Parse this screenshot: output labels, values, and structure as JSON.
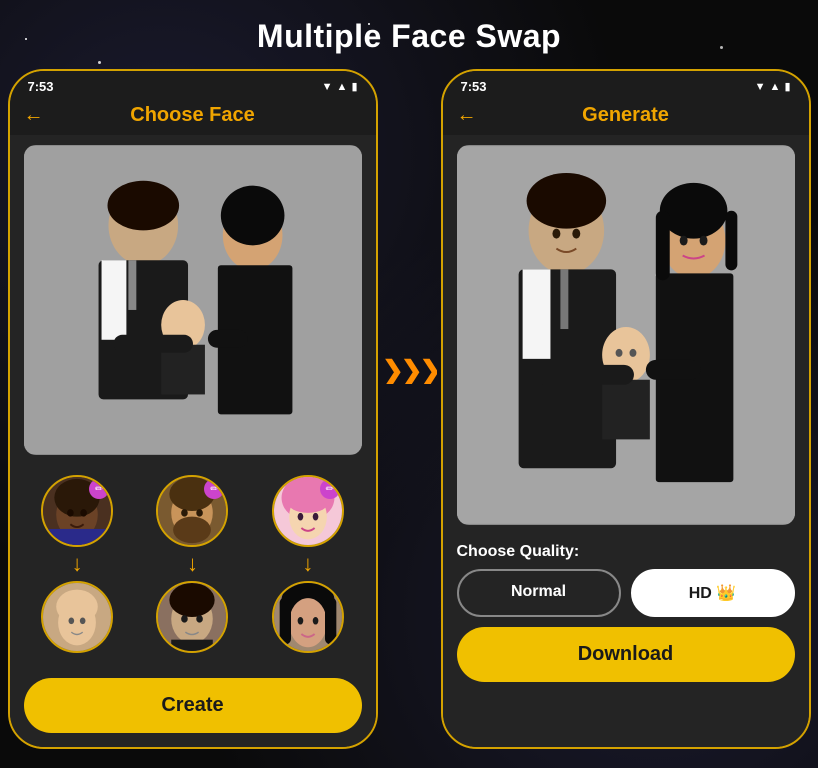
{
  "page": {
    "title": "Multiple Face Swap",
    "background_color": "#0a0a0a",
    "accent_color": "#f0a500",
    "border_color": "#d4a200"
  },
  "left_phone": {
    "status_time": "7:53",
    "nav_title": "Choose Face",
    "back_arrow": "←",
    "face_pairs": [
      {
        "id": 1,
        "has_edit": true,
        "edit_symbol": "✏"
      },
      {
        "id": 2,
        "has_edit": true,
        "edit_symbol": "✏"
      },
      {
        "id": 3,
        "has_edit": true,
        "edit_symbol": "✏"
      }
    ],
    "create_btn_label": "Create"
  },
  "right_phone": {
    "status_time": "7:53",
    "nav_title": "Generate",
    "back_arrow": "←",
    "quality_label": "Choose Quality:",
    "quality_options": [
      {
        "label": "Normal",
        "type": "normal"
      },
      {
        "label": "HD 👑",
        "type": "hd"
      }
    ],
    "download_btn_label": "Download"
  },
  "arrow_between": "❯❯❯❯❯"
}
